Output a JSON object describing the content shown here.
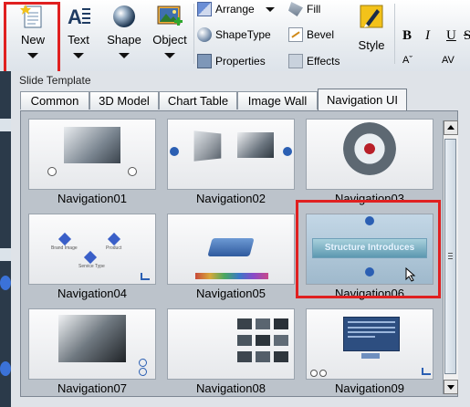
{
  "ribbon": {
    "new_label": "New",
    "text_label": "Text",
    "shape_label": "Shape",
    "object_label": "Object",
    "arrange_label": "Arrange",
    "shapetype_label": "ShapeType",
    "properties_label": "Properties",
    "fill_label": "Fill",
    "bevel_label": "Bevel",
    "effects_label": "Effects",
    "style_label": "Style",
    "bold": "B",
    "italic": "I",
    "underline": "U",
    "strike": "S",
    "size": "Aˇ",
    "spacing": "AV"
  },
  "dialog": {
    "title": "Slide Template",
    "tabs": [
      "Common",
      "3D Model",
      "Chart Table",
      "Image Wall",
      "Navigation UI"
    ],
    "active_tab": "Navigation UI",
    "templates": [
      "Navigation01",
      "Navigation02",
      "Navigation03",
      "Navigation04",
      "Navigation05",
      "Navigation06",
      "Navigation07",
      "Navigation08",
      "Navigation09"
    ],
    "selected": "Navigation06",
    "thumb6_text": "Structure Introduces",
    "thumb4_labels": [
      "Brand Image",
      "Product",
      "Service Type"
    ]
  },
  "colors": {
    "highlight": "#e02020",
    "nav_blue": "#2b5fb3"
  }
}
